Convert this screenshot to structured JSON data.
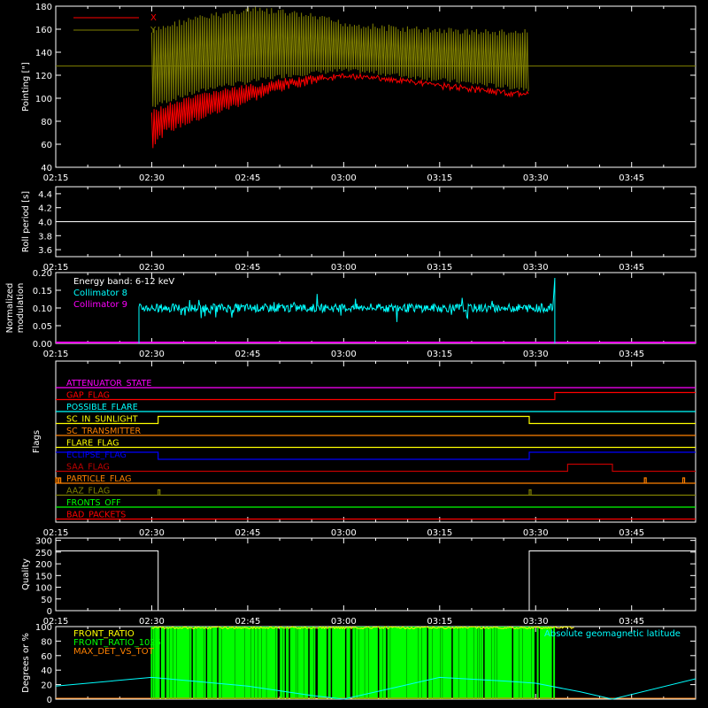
{
  "time_ticks": [
    "02:15",
    "02:30",
    "02:45",
    "03:00",
    "03:15",
    "03:30",
    "03:45"
  ],
  "colors": {
    "axes": "#ffffff",
    "red": "#ff0000",
    "olive": "#808000",
    "cyan": "#00ffff",
    "magenta": "#ff00ff",
    "yellow": "#ffff00",
    "orange": "#ff8000",
    "green": "#00ff00",
    "blue": "#0000ff",
    "darkred": "#c00000"
  },
  "chart_data": [
    {
      "type": "line",
      "ylabel": "Pointing [\"]",
      "ylim": [
        40,
        180
      ],
      "yticks": [
        40,
        60,
        80,
        100,
        120,
        140,
        160,
        180
      ],
      "xlim": [
        "02:15",
        "03:55"
      ],
      "legend": [
        "X",
        "Y"
      ],
      "series": [
        {
          "name": "X",
          "band": true,
          "x": [
            "02:30",
            "02:32",
            "02:35",
            "02:40",
            "02:45",
            "02:50",
            "02:55",
            "03:00",
            "03:05",
            "03:10",
            "03:15",
            "03:20",
            "03:25",
            "03:29"
          ],
          "low": [
            55,
            68,
            75,
            85,
            95,
            105,
            112,
            117,
            115,
            112,
            108,
            105,
            102,
            100
          ],
          "high": [
            90,
            95,
            100,
            108,
            112,
            117,
            120,
            122,
            120,
            117,
            114,
            111,
            108,
            106
          ]
        },
        {
          "name": "Y",
          "band": true,
          "x": [
            "02:30",
            "02:32",
            "02:35",
            "02:40",
            "02:45",
            "02:50",
            "02:55",
            "03:00",
            "03:05",
            "03:10",
            "03:15",
            "03:20",
            "03:25",
            "03:29"
          ],
          "low": [
            90,
            95,
            100,
            108,
            112,
            117,
            120,
            122,
            120,
            117,
            114,
            111,
            108,
            106
          ],
          "high": [
            160,
            165,
            170,
            175,
            180,
            178,
            174,
            168,
            165,
            163,
            162,
            161,
            160,
            160
          ]
        },
        {
          "name": "",
          "x": [
            "02:15",
            "03:55"
          ],
          "y": [
            128,
            128
          ]
        }
      ]
    },
    {
      "type": "line",
      "ylabel": "Roll period [s]",
      "ylim": [
        3.5,
        4.5
      ],
      "yticks": [
        3.6,
        3.8,
        4.0,
        4.2,
        4.4
      ],
      "xlim": [
        "02:15",
        "03:55"
      ],
      "series": [
        {
          "name": "",
          "x": [
            "02:15",
            "03:55"
          ],
          "y": [
            4.0,
            4.0
          ]
        }
      ]
    },
    {
      "type": "line",
      "ylabel": "Normalized modulation",
      "ylim": [
        0,
        0.2
      ],
      "yticks": [
        0.0,
        0.05,
        0.1,
        0.15,
        0.2
      ],
      "xlim": [
        "02:15",
        "03:55"
      ],
      "annotation": "Energy band: 6-12 keV",
      "legend": [
        "Collimator 8",
        "Collimator 9"
      ],
      "series": [
        {
          "name": "Collimator 8",
          "start": "02:28",
          "end": "03:33",
          "mean": 0.1,
          "noise": 0.012,
          "end_spike": 0.185
        },
        {
          "name": "Collimator 9",
          "x": [
            "02:15",
            "03:55"
          ],
          "y": [
            0.0,
            0.0
          ]
        }
      ]
    },
    {
      "type": "line",
      "ylabel": "Flags",
      "xlim": [
        "02:15",
        "03:55"
      ],
      "flags": [
        {
          "label": "ATTENUATOR_STATE",
          "color": "#ff00ff",
          "steps": []
        },
        {
          "label": "GAP_FLAG",
          "color": "#ff0000",
          "steps": [
            [
              "03:33",
              1
            ]
          ]
        },
        {
          "label": "POSSIBLE_FLARE",
          "color": "#00ffff",
          "steps": []
        },
        {
          "label": "SC_IN_SUNLIGHT",
          "color": "#ffff00",
          "steps": [
            [
              "02:31",
              1
            ],
            [
              "03:29",
              0
            ]
          ]
        },
        {
          "label": "SC_TRANSMITTER",
          "color": "#ff8000",
          "steps": []
        },
        {
          "label": "FLARE_FLAG",
          "color": "#ffff00",
          "steps": []
        },
        {
          "label": "ECLIPSE_FLAG",
          "color": "#0000ff",
          "steps": [
            [
              "02:31",
              0
            ],
            [
              "03:29",
              1
            ]
          ],
          "start_high": true
        },
        {
          "label": "SAA_FLAG",
          "color": "#c00000",
          "steps": [
            [
              "03:35",
              1
            ],
            [
              "03:42",
              0
            ]
          ]
        },
        {
          "label": "PARTICLE_FLAG",
          "color": "#ff8000",
          "spikes": [
            "02:15",
            "02:15.5",
            "03:47",
            "03:53"
          ]
        },
        {
          "label": "AAZ_FLAG",
          "color": "#808000",
          "spikes": [
            "02:31",
            "03:29"
          ]
        },
        {
          "label": "FRONTS_OFF",
          "color": "#00ff00",
          "steps": []
        },
        {
          "label": "BAD_PACKETS",
          "color": "#ff0000",
          "steps": []
        }
      ]
    },
    {
      "type": "line",
      "ylabel": "Quality",
      "ylim": [
        0,
        310
      ],
      "yticks": [
        0,
        50,
        100,
        150,
        200,
        250,
        300
      ],
      "xlim": [
        "02:15",
        "03:55"
      ],
      "series": [
        {
          "name": "",
          "x": [
            "02:15",
            "02:31",
            "02:31",
            "03:29",
            "03:29",
            "03:55"
          ],
          "y": [
            255,
            255,
            0,
            0,
            255,
            255
          ]
        }
      ]
    },
    {
      "type": "line",
      "ylabel": "Degrees or %",
      "ylim": [
        0,
        100
      ],
      "yticks": [
        0,
        20,
        40,
        60,
        80,
        100
      ],
      "xlim": [
        "02:15",
        "03:55"
      ],
      "legend": [
        "FRONT_RATIO",
        "FRONT_RATIO_1025",
        "MAX_DET_VS_TOT"
      ],
      "legend_right": "Absolute geomagnetic latitude",
      "series": [
        {
          "name": "FRONT_RATIO",
          "start": "02:30",
          "end": "03:33",
          "level": 100
        },
        {
          "name": "FRONT_RATIO_1025",
          "start": "02:30",
          "end": "03:33",
          "bars": true
        },
        {
          "name": "MAX_DET_VS_TOT",
          "x": [
            "02:15",
            "03:55"
          ],
          "y": [
            0,
            0
          ]
        },
        {
          "name": "Absolute geomagnetic latitude",
          "x": [
            "02:15",
            "02:30",
            "02:45",
            "02:55",
            "03:00",
            "03:15",
            "03:25",
            "03:30",
            "03:37",
            "03:42",
            "03:55"
          ],
          "y": [
            18,
            30,
            18,
            5,
            0,
            30,
            25,
            22,
            10,
            0,
            28
          ]
        }
      ]
    }
  ]
}
